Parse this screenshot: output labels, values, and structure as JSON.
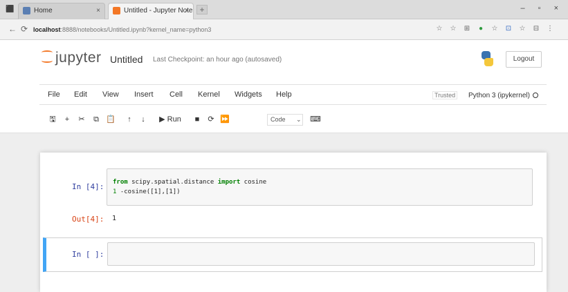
{
  "browser": {
    "tabs": [
      {
        "title": "Home",
        "close": "×"
      },
      {
        "title": "Untitled - Jupyter Notebook",
        "close": "×"
      }
    ],
    "new_tab": "+",
    "app_icon": "⬛",
    "window_controls": "– ▫ ×",
    "nav": {
      "back": "←",
      "reload": "⟳"
    },
    "url_host": "localhost",
    "url_path": ":8888/notebooks/Untitled.ipynb?kernel_name=python3",
    "ext_icons": [
      "☆",
      "☆",
      "⊞",
      "●",
      "☆",
      "⊡",
      "☆",
      "⊟",
      "⋮"
    ]
  },
  "header": {
    "brand": "jupyter",
    "notebook_title": "Untitled",
    "checkpoint": "Last Checkpoint: an hour ago (autosaved)",
    "logout_label": "Logout"
  },
  "menubar": {
    "items": [
      "File",
      "Edit",
      "View",
      "Insert",
      "Cell",
      "Kernel",
      "Widgets",
      "Help"
    ],
    "trusted": "Trusted",
    "kernel": "Python 3 (ipykernel)"
  },
  "toolbar": {
    "buttons": [
      "🖫",
      "+",
      "✂",
      "⧉",
      "📋",
      "↑",
      "↓",
      "▶ Run",
      "■",
      "⟳",
      "⏩"
    ],
    "cell_type": "Code",
    "cell_type_caret": "⌄",
    "keyboard_icon": "⌨"
  },
  "cells": [
    {
      "prompt_in": "In [4]:",
      "code_kw_from": "from",
      "code_module": " scipy.spatial.distance ",
      "code_kw_import": "import",
      "code_name": " cosine",
      "code_line2_num": "1",
      "code_line2_rest": " -cosine([1],[1])",
      "prompt_out": "Out[4]:",
      "output": "1"
    },
    {
      "prompt_in": "In [ ]:"
    }
  ]
}
